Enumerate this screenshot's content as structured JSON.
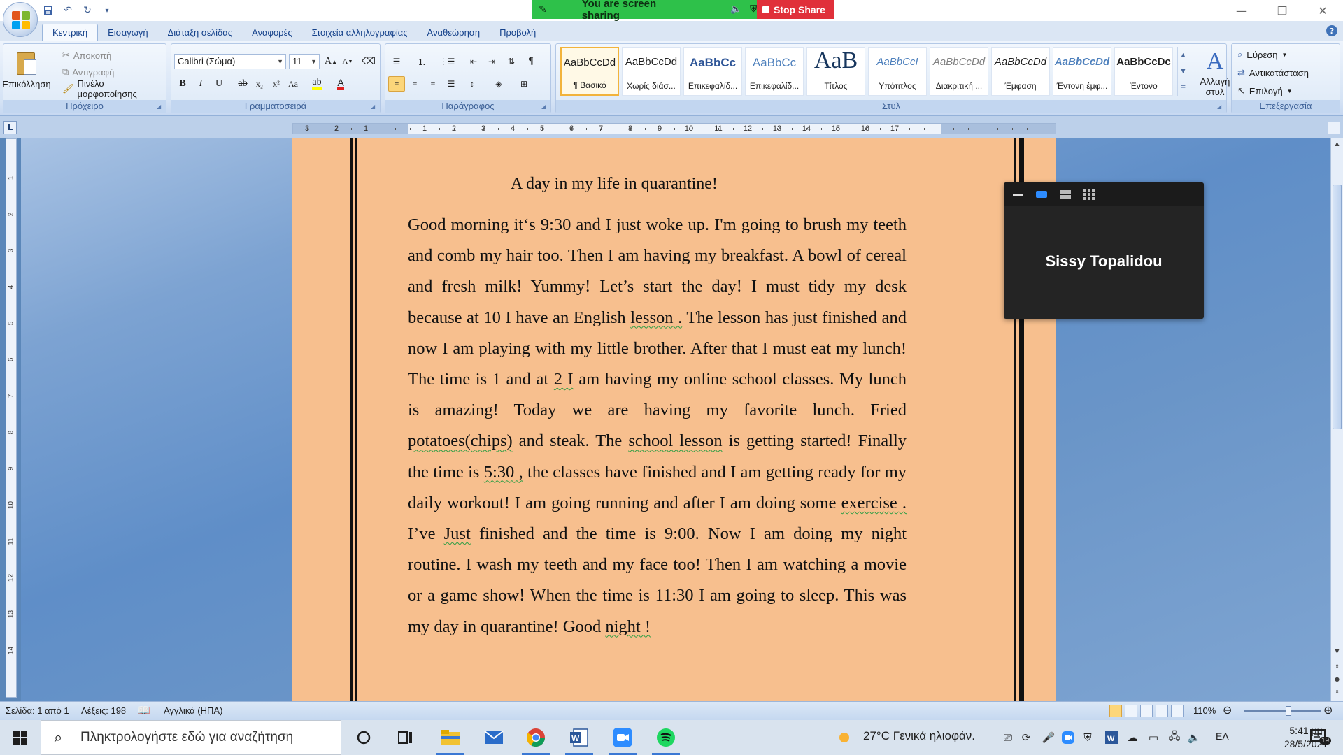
{
  "titlebar": {
    "share_message": "You are screen sharing",
    "stop_share_label": "Stop Share"
  },
  "ribbon_tabs": [
    "Κεντρική",
    "Εισαγωγή",
    "Διάταξη σελίδας",
    "Αναφορές",
    "Στοιχεία αλληλογραφίας",
    "Αναθεώρηση",
    "Προβολή"
  ],
  "active_tab": "Κεντρική",
  "clipboard": {
    "paste_label": "Επικόλληση",
    "cut_label": "Αποκοπή",
    "copy_label": "Αντιγραφή",
    "format_painter_label": "Πινέλο μορφοποίησης",
    "group_label": "Πρόχειρο"
  },
  "font": {
    "font_name": "Calibri (Σώμα)",
    "font_size": "11",
    "group_label": "Γραμματοσειρά"
  },
  "paragraph": {
    "group_label": "Παράγραφος"
  },
  "styles": {
    "group_label": "Στυλ",
    "change_styles_label": "Αλλαγή στυλ",
    "items": [
      {
        "sample": "AaBbCcDd",
        "name": "¶ Βασικό"
      },
      {
        "sample": "AaBbCcDd",
        "name": "Χωρίς διάσ..."
      },
      {
        "sample": "AaBbCc",
        "name": "Επικεφαλίδ..."
      },
      {
        "sample": "AaBbCc",
        "name": "Επικεφαλίδ..."
      },
      {
        "sample": "AaB",
        "name": "Τίτλος"
      },
      {
        "sample": "AaBbCcI",
        "name": "Υπότιτλος"
      },
      {
        "sample": "AaBbCcDd",
        "name": "Διακριτική ..."
      },
      {
        "sample": "AaBbCcDd",
        "name": "Έμφαση"
      },
      {
        "sample": "AaBbCcDd",
        "name": "Έντονη έμφ..."
      },
      {
        "sample": "AaBbCcDc",
        "name": "Έντονο"
      }
    ]
  },
  "editing": {
    "group_label": "Επεξεργασία",
    "find_label": "Εύρεση",
    "replace_label": "Αντικατάσταση",
    "select_label": "Επιλογή"
  },
  "ruler": {
    "ticks": [
      "3",
      "2",
      "1",
      "1",
      "2",
      "3",
      "4",
      "5",
      "6",
      "7",
      "8",
      "9",
      "10",
      "11",
      "12",
      "13",
      "14",
      "15",
      "16",
      "17"
    ],
    "vertical_ticks": [
      "1",
      "2",
      "3",
      "4",
      "5",
      "6",
      "7",
      "8",
      "9",
      "10",
      "11",
      "12",
      "13",
      "14"
    ]
  },
  "document": {
    "title": "A day in my life in quarantine!",
    "body": [
      {
        "t": "Good morning it‘s 9:30 and I just woke up. I'm going to brush my teeth and comb my hair too. Then I am having my breakfast. A bowl of cereal and fresh milk! Yummy! Let’s start the day! I must tidy my desk because at 10 I have an English "
      },
      {
        "t": "lesson .",
        "err": true
      },
      {
        "t": " The lesson has just finished and now I am playing with my little brother. After that I must eat my lunch! The time is 1 and at "
      },
      {
        "t": "2  I",
        "err": true
      },
      {
        "t": " am having my online school classes. My lunch is amazing! Today we are having my favorite lunch. Fried "
      },
      {
        "t": "potatoes(chips)",
        "err": true
      },
      {
        "t": " and steak. The "
      },
      {
        "t": "school  lesson",
        "err": true
      },
      {
        "t": " is getting started! Finally the time is "
      },
      {
        "t": "5:30 ,",
        "err": true
      },
      {
        "t": " the classes have finished and I am getting ready for my daily workout! I am going running and after I am doing some "
      },
      {
        "t": "exercise .",
        "err": true
      },
      {
        "t": " I’ve "
      },
      {
        "t": "Just",
        "err": true
      },
      {
        "t": " finished and the time is 9:00. Now I am doing my night routine. I wash my teeth and my face too! Then I am watching a movie or a game show! When the time is 11:30 I am going to sleep. This was my day in quarantine! Good "
      },
      {
        "t": "night !",
        "err": true
      }
    ]
  },
  "zoom_tile": {
    "participant_name": "Sissy Topalidou"
  },
  "statusbar": {
    "page": "Σελίδα: 1 από 1",
    "words": "Λέξεις: 198",
    "language": "Αγγλικά (ΗΠΑ)",
    "zoom": "110%"
  },
  "taskbar": {
    "search_placeholder": "Πληκτρολογήστε εδώ για αναζήτηση",
    "weather": "27°C  Γενικά ηλιοφάν.",
    "input_lang": "ΕΛ",
    "time": "5:41 μμ",
    "date": "28/5/2021",
    "notification_count": "19"
  },
  "colors": {
    "page_background": "#f7bf8e",
    "share_bar": "#2ec14a",
    "stop_share": "#e0303a",
    "spelling_underline": "#2f9e44"
  }
}
